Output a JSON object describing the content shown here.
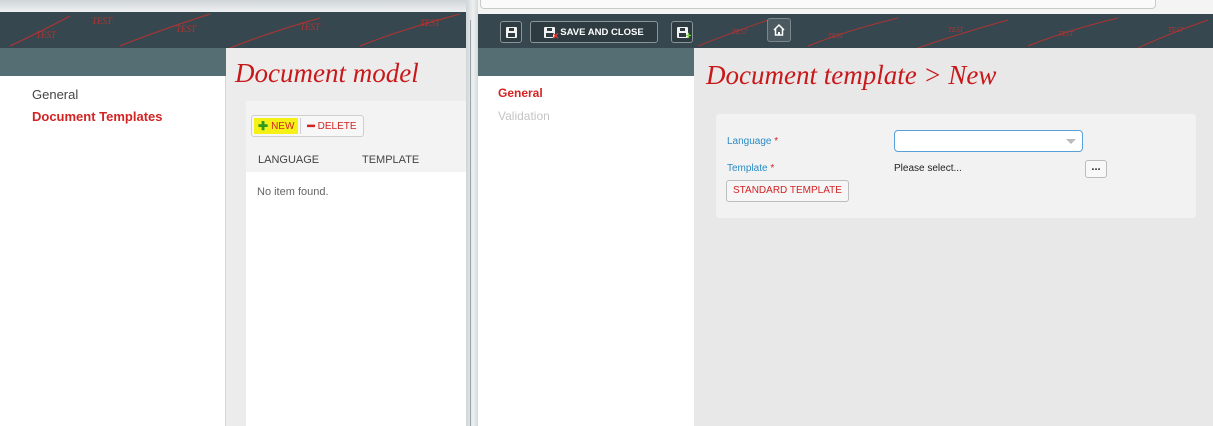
{
  "left_window": {
    "title": "Document model",
    "nav": [
      {
        "label": "General",
        "active": false
      },
      {
        "label": "Document Templates",
        "active": true
      }
    ],
    "toolbar": {
      "new_label": "NEW",
      "delete_label": "DELETE"
    },
    "columns": [
      "LANGUAGE",
      "TEMPLATE"
    ],
    "empty_message": "No item found."
  },
  "right_window": {
    "toolbar": {
      "save_close_label": "SAVE AND CLOSE"
    },
    "title": "Document template > New",
    "nav": [
      {
        "label": "General",
        "active": true
      },
      {
        "label": "Validation",
        "active": false
      }
    ],
    "form": {
      "language_label": "Language",
      "language_value": "",
      "template_label": "Template",
      "required_mark": "*",
      "template_value": "Please select...",
      "browse_label": "...",
      "standard_template_label": "STANDARD TEMPLATE"
    }
  },
  "header_watermark": "TEST",
  "colors": {
    "header_bg": "#37474f",
    "subbar_bg": "#546e73",
    "accent_red": "#c8181a",
    "label_blue": "#2b8bc5",
    "new_button_highlight": "#f5f116"
  },
  "icons": [
    "save-icon",
    "save-close-icon",
    "save-new-icon",
    "home-icon",
    "plus-icon",
    "minus-icon",
    "dropdown-arrow-icon"
  ]
}
